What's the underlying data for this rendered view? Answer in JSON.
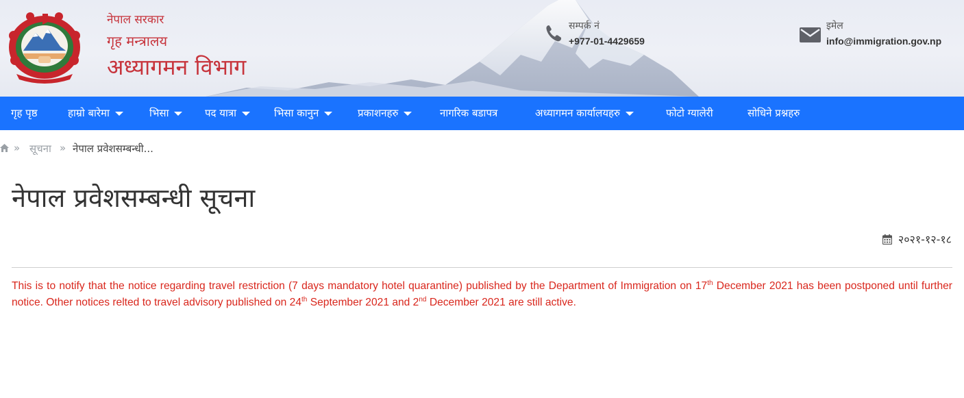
{
  "header": {
    "gov_line1": "नेपाल सरकार",
    "gov_line2": "गृह मन्त्रालय",
    "gov_title": "अध्यागमन विभाग",
    "contact_label": "सम्पर्क नं",
    "contact_value": "+977-01-4429659",
    "email_label": "इमेल",
    "email_value": "info@immigration.gov.np",
    "icons": [
      "nepal-emblem",
      "phone-icon",
      "envelope-icon"
    ]
  },
  "nav": {
    "items": [
      {
        "label": "गृह पृष्ठ",
        "dropdown": false
      },
      {
        "label": "हाम्रो बारेमा",
        "dropdown": true
      },
      {
        "label": "भिसा",
        "dropdown": true
      },
      {
        "label": "पद यात्रा",
        "dropdown": true
      },
      {
        "label": "भिसा कानुन",
        "dropdown": true
      },
      {
        "label": "प्रकाशनहरु",
        "dropdown": true
      },
      {
        "label": "नागरिक बडापत्र",
        "dropdown": false
      },
      {
        "label": "अध्यागमन कार्यालयहरु",
        "dropdown": true
      },
      {
        "label": "फोटो ग्यालेरी",
        "dropdown": false
      },
      {
        "label": "सोधिने प्रश्नहरु",
        "dropdown": false
      }
    ]
  },
  "breadcrumb": {
    "separator": "»",
    "link": "सूचना",
    "current": "नेपाल प्रवेशसम्बन्धी..."
  },
  "article": {
    "title": "नेपाल प्रवेशसम्बन्धी सूचना",
    "date": "२०२१-१२-१८",
    "p1": "This is to notify that the notice regarding travel restriction (7 days mandatory hotel quarantine) published by the Department of Immigration on 17",
    "p1_sup": "th",
    "p2": " December 2021 has been postponed until further notice. Other notices relted to travel advisory published on 24",
    "p2_sup": "th",
    "p3": " September 2021 and 2",
    "p3_sup": "nd",
    "p4": " December 2021 are still active."
  },
  "colors": {
    "nav_bg": "#1a73ff",
    "brand_red": "#c7343c",
    "notice_red": "#d9261c"
  }
}
